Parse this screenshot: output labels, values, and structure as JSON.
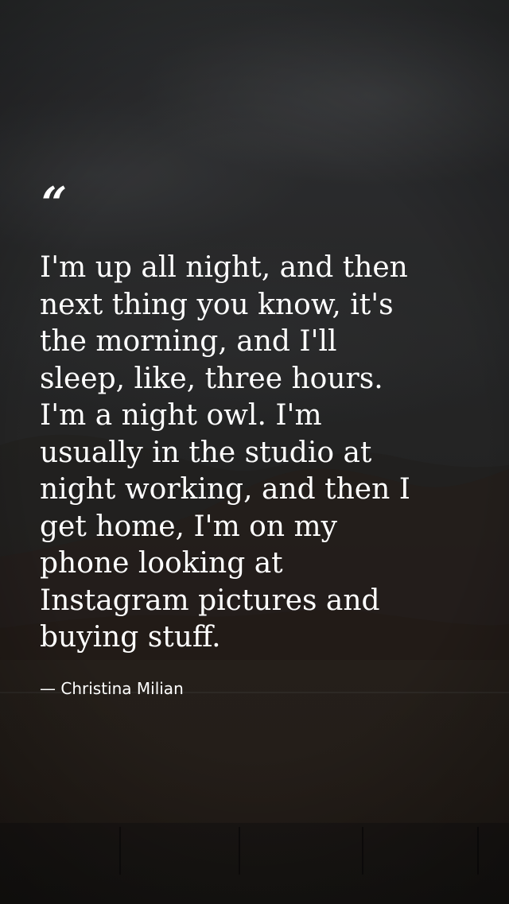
{
  "quote": {
    "mark": "“",
    "lines": [
      "I'm up all night, and then",
      "next thing you know, it's",
      "the morning, and I'll",
      "sleep, like, three hours.",
      "I'm a night owl. I'm",
      "usually in the studio at",
      "night working, and then I",
      "get home, I'm on my",
      "phone looking at",
      "Instagram pictures and",
      "buying stuff."
    ],
    "attribution": "— Christina Milian"
  },
  "colors": {
    "text": "#ffffff",
    "sky": "#343537",
    "ground": "#2d251f"
  }
}
